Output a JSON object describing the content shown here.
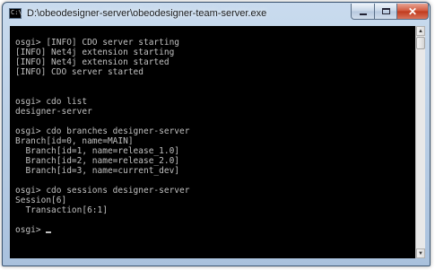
{
  "window": {
    "title": "D:\\obeodesigner-server\\obeodesigner-team-server.exe",
    "icon": "console-icon",
    "controls": {
      "minimize": "minimize-icon",
      "maximize": "maximize-icon",
      "close_label": "✕"
    }
  },
  "console": {
    "background": "#000000",
    "foreground": "#c0c0c0",
    "lines": [
      "osgi> [INFO] CDO server starting",
      "[INFO] Net4j extension starting",
      "[INFO] Net4j extension started",
      "[INFO] CDO server started",
      "",
      "",
      "osgi> cdo list",
      "designer-server",
      "",
      "osgi> cdo branches designer-server",
      "Branch[id=0, name=MAIN]",
      "  Branch[id=1, name=release_1.0]",
      "  Branch[id=2, name=release_2.0]",
      "  Branch[id=3, name=current_dev]",
      "",
      "osgi> cdo sessions designer-server",
      "Session[6]",
      "  Transaction[6:1]",
      "",
      "osgi> "
    ]
  },
  "scrollbar": {
    "up_arrow": "▲",
    "down_arrow": "▼"
  }
}
